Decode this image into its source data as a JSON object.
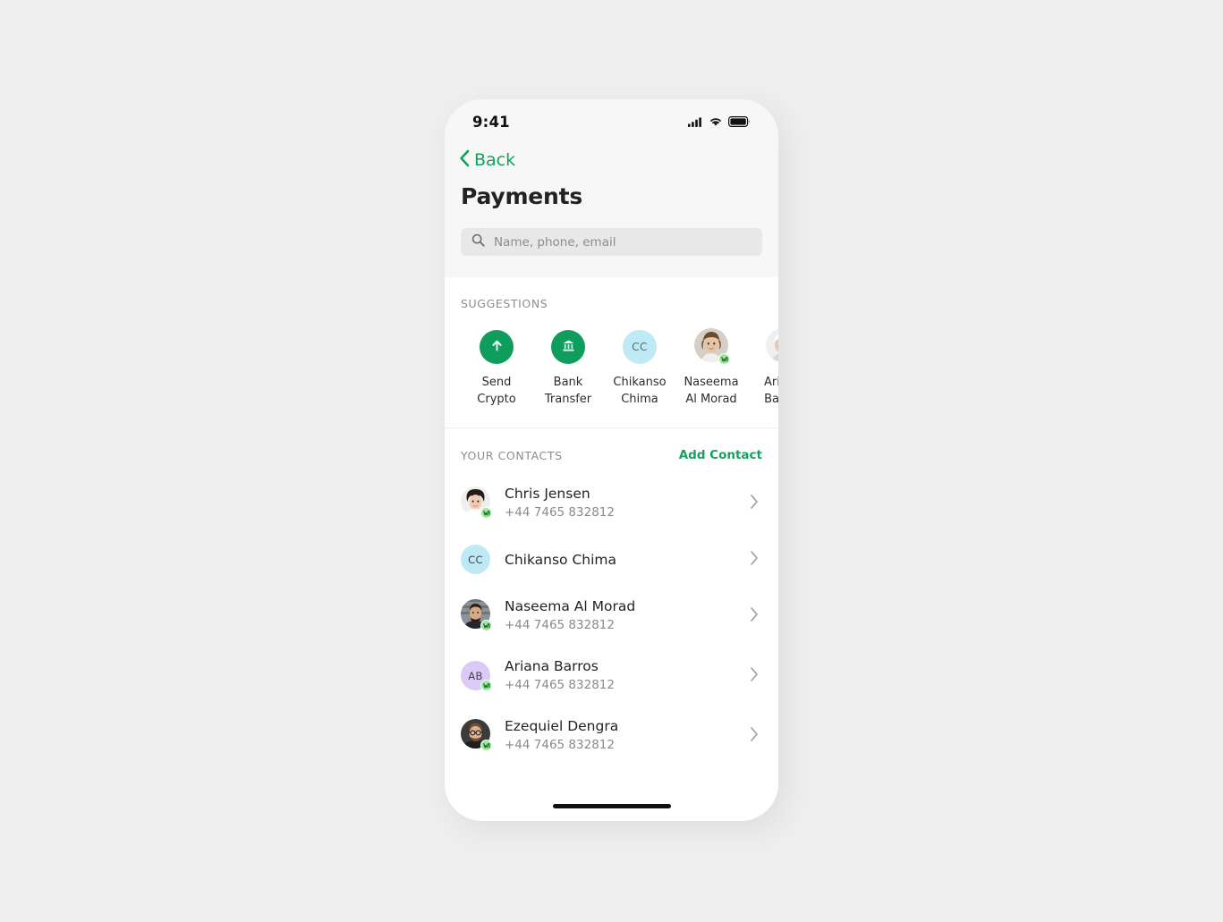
{
  "status_bar": {
    "time": "9:41",
    "cellular_icon": "cellular-signal-icon",
    "wifi_icon": "wifi-icon",
    "battery_icon": "battery-icon"
  },
  "nav": {
    "back_label": "Back",
    "back_icon": "chevron-left-icon"
  },
  "header": {
    "title": "Payments"
  },
  "search": {
    "placeholder": "Name, phone, email",
    "value": "",
    "icon": "search-icon"
  },
  "suggestions": {
    "label": "SUGGESTIONS",
    "items": [
      {
        "name": "Send\nCrypto",
        "kind": "action",
        "icon": "arrow-up-icon",
        "bg": "#0e9d5d",
        "initials": "",
        "verified": false
      },
      {
        "name": "Bank\nTransfer",
        "kind": "action",
        "icon": "bank-building-icon",
        "bg": "#0e9d5d",
        "initials": "",
        "verified": false
      },
      {
        "name": "Chikanso\nChima",
        "kind": "contact",
        "icon": "avatar-initials",
        "bg": "#bfe9f4",
        "initials": "CC",
        "verified": false
      },
      {
        "name": "Naseema\nAl Morad",
        "kind": "contact",
        "icon": "avatar-photo",
        "bg": "#c8b79d",
        "initials": "",
        "verified": true
      },
      {
        "name": "Ariana\nBarros",
        "kind": "contact",
        "icon": "avatar-photo",
        "bg": "#e3e3e3",
        "initials": "",
        "verified": true
      }
    ]
  },
  "contacts": {
    "label": "YOUR CONTACTS",
    "add_label": "Add Contact",
    "chevron_icon": "chevron-right-icon",
    "items": [
      {
        "name": "Chris Jensen",
        "phone": "+44 7465 832812",
        "avatar_type": "photo",
        "avatar_bg": "#d9d3cc",
        "initials": "",
        "verified": true
      },
      {
        "name": "Chikanso Chima",
        "phone": "",
        "avatar_type": "initials",
        "avatar_bg": "#bfe9f4",
        "initials": "CC",
        "verified": false
      },
      {
        "name": "Naseema Al Morad",
        "phone": "+44 7465 832812",
        "avatar_type": "photo",
        "avatar_bg": "#9aa0a6",
        "initials": "",
        "verified": true
      },
      {
        "name": "Ariana Barros",
        "phone": "+44 7465 832812",
        "avatar_type": "initials",
        "avatar_bg": "#dcc9f5",
        "initials": "AB",
        "verified": true
      },
      {
        "name": "Ezequiel Dengra",
        "phone": "+44 7465 832812",
        "avatar_type": "photo",
        "avatar_bg": "#6d5a49",
        "initials": "",
        "verified": true
      }
    ]
  },
  "home_indicator": "home-indicator",
  "colors": {
    "brand_green": "#16a05d",
    "action_green": "#0e9d5d",
    "badge_green": "#9fe8a0",
    "screen_bg": "#f7f7f7",
    "card_bg": "#ffffff",
    "page_bg": "#eeeeee",
    "muted_text": "#8d8d8d"
  }
}
